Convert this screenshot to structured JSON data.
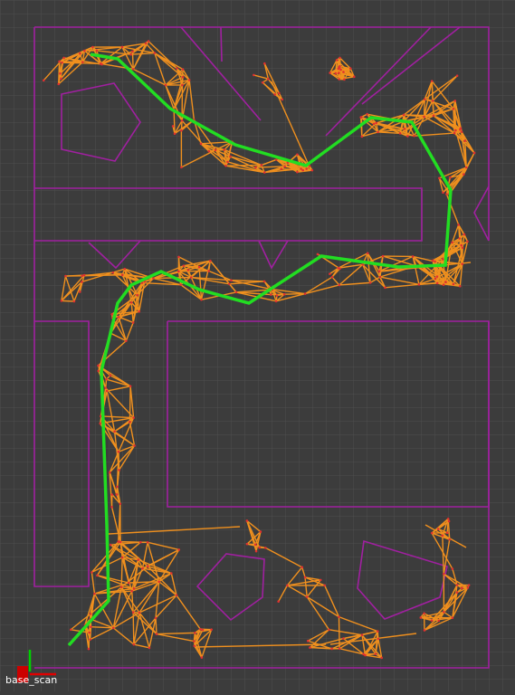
{
  "app": "rviz",
  "frame_label": "base_scan",
  "colors": {
    "background": "#3c3c3c",
    "grid": "#4e4e4e",
    "obstacles": "#a020a0",
    "roadmap": "#f0901e",
    "path": "#22dd22",
    "axis_x": "#e00000",
    "axis_y": "#00d000"
  },
  "icons": [
    "frame-axes-icon"
  ]
}
